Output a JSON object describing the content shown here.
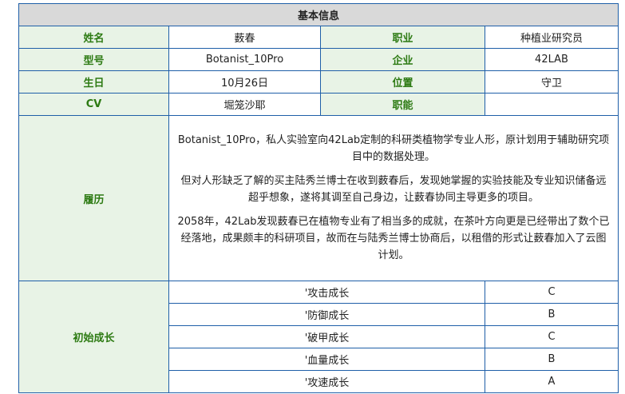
{
  "title": "基本信息",
  "rows": [
    {
      "label1": "姓名",
      "value1": "薮春",
      "label2": "职业",
      "value2": "种植业研究员"
    },
    {
      "label1": "型号",
      "value1": "Botanist_10Pro",
      "label2": "企业",
      "value2": "42LAB"
    },
    {
      "label1": "生日",
      "value1": "10月26日",
      "label2": "位置",
      "value2": "守卫"
    },
    {
      "label1": "CV",
      "value1": "堀笼沙耶",
      "label2": "职能",
      "value2": ""
    }
  ],
  "resume": {
    "label": "履历",
    "paragraphs": [
      "Botanist_10Pro，私人实验室向42Lab定制的科研类植物学专业人形，原计划用于辅助研究项目中的数据处理。",
      "但对人形缺乏了解的买主陆秀兰博士在收到薮春后，发现她掌握的实验技能及专业知识储备远超乎想象，遂将其调至自己身边，让薮春协同主导更多的项目。",
      "2058年，42Lab发现薮春已在植物专业有了相当多的成就，在茶叶方向更是已经带出了数个已经落地，成果颇丰的科研项目，故而在与陆秀兰博士协商后，以租借的形式让薮春加入了云图计划。"
    ]
  },
  "growth": {
    "label": "初始成长",
    "items": [
      {
        "name": "'攻击成长",
        "grade": "C"
      },
      {
        "name": "'防御成长",
        "grade": "B"
      },
      {
        "name": "'破甲成长",
        "grade": "C"
      },
      {
        "name": "'血量成长",
        "grade": "B"
      },
      {
        "name": "'攻速成长",
        "grade": "A"
      }
    ]
  }
}
